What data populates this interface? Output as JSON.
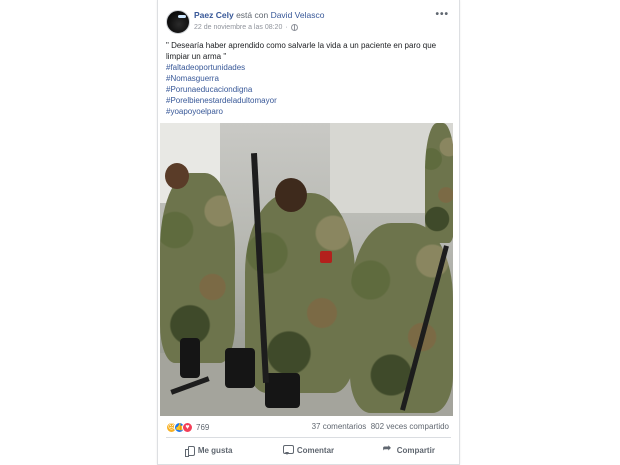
{
  "post": {
    "author": "Paez Cely",
    "with_text": " está con ",
    "tagged": "David Velasco",
    "timestamp": "22 de noviembre a las 08:20",
    "meta_separator": " · ",
    "body": "\" Desearía haber aprendido como salvarle la vida a un paciente en paro que limpiar un arma \"",
    "hashtags": [
      "#faltadeoportunidades",
      "#Nomasguerra",
      "#Porunaeducaciondigna",
      "#Porelbienestardeladultomayor",
      "#yoapoyoelparo"
    ]
  },
  "engagement": {
    "reaction_count": "769",
    "comments": "37 comentarios",
    "shares": "802 veces compartido"
  },
  "actions": {
    "like": "Me gusta",
    "comment": "Comentar",
    "share": "Compartir"
  },
  "icons": [
    "more-options-icon",
    "globe-icon",
    "sad-reaction-icon",
    "like-reaction-icon",
    "love-reaction-icon",
    "like-icon",
    "comment-icon",
    "share-icon"
  ],
  "colors": {
    "link": "#385898",
    "muted": "#606770",
    "like_blue": "#1877f2",
    "love_red": "#f33e58",
    "sad_yellow": "#f7b125"
  }
}
